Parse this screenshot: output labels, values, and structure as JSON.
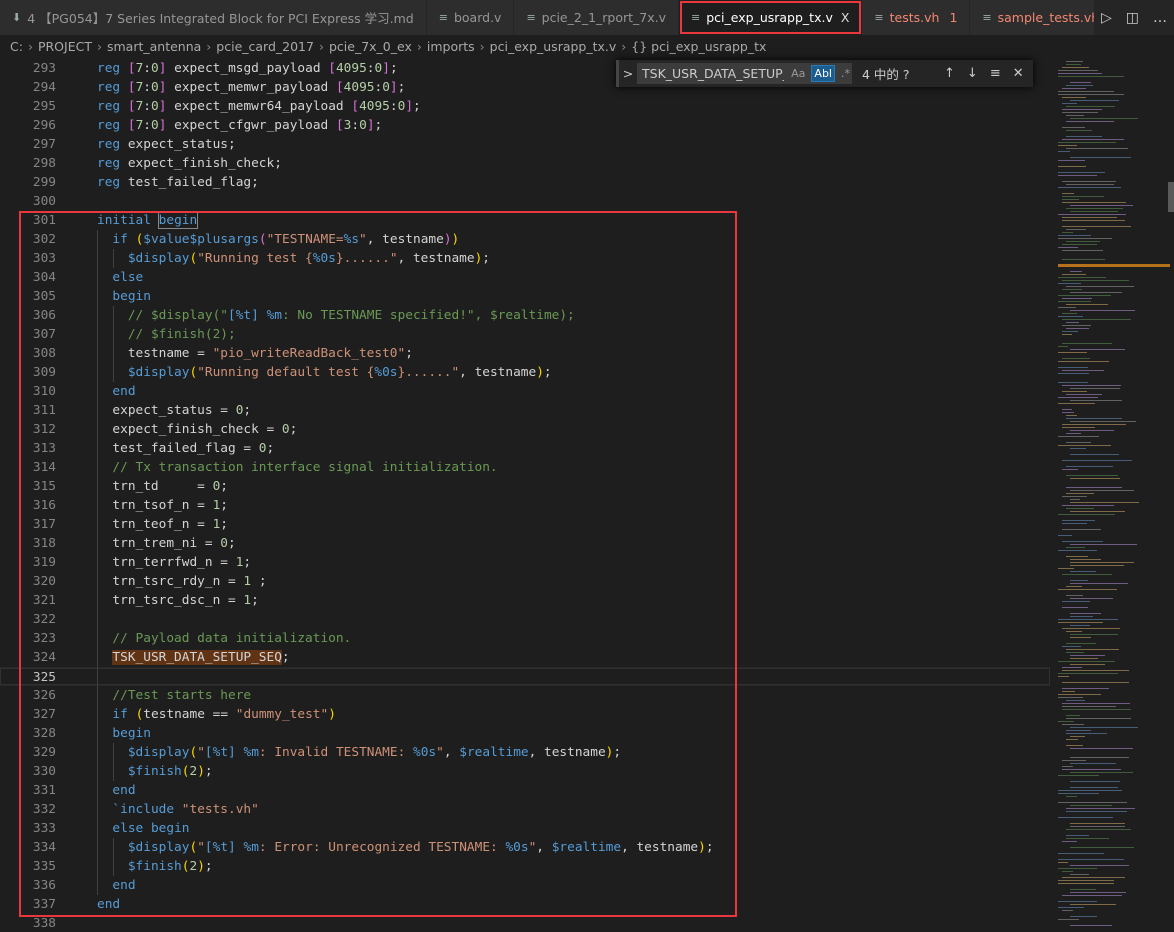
{
  "tabs": [
    {
      "label": "4 【PG054】7 Series Integrated Block for PCI Express 学习.md",
      "icon": "markdown-download-icon"
    },
    {
      "label": "board.v",
      "icon": "file-icon"
    },
    {
      "label": "pcie_2_1_rport_7x.v",
      "icon": "file-icon"
    },
    {
      "label": "pci_exp_usrapp_tx.v",
      "icon": "file-icon",
      "active": true,
      "close": "X"
    },
    {
      "label": "tests.vh",
      "icon": "file-icon",
      "badge": "1",
      "error": true
    },
    {
      "label": "sample_tests.vh",
      "icon": "file-icon",
      "error": true
    }
  ],
  "tab_actions": {
    "run": "▷",
    "split": "◫",
    "more": "…"
  },
  "breadcrumb": [
    "C:",
    "PROJECT",
    "smart_antenna",
    "pcie_card_2017",
    "pcie_7x_0_ex",
    "imports",
    "pci_exp_usrapp_tx.v",
    "{} pci_exp_usrapp_tx"
  ],
  "find": {
    "toggle": ">",
    "value": "TSK_USR_DATA_SETUP_SEQ",
    "match_case": "Aa",
    "whole_word": "Abl",
    "regex": ".*",
    "result": "4 中的 ?",
    "prev": "↑",
    "next": "↓",
    "selection": "≡",
    "close": "✕"
  },
  "editor": {
    "first_line": 293,
    "current_line": 325,
    "lines": [
      "reg [7:0] expect_msgd_payload [4095:0];",
      "reg [7:0] expect_memwr_payload [4095:0];",
      "reg [7:0] expect_memwr64_payload [4095:0];",
      "reg [7:0] expect_cfgwr_payload [3:0];",
      "reg expect_status;",
      "reg expect_finish_check;",
      "reg test_failed_flag;",
      "",
      "initial begin",
      "  if ($value$plusargs(\"TESTNAME=%s\", testname))",
      "    $display(\"Running test {%0s}......\", testname);",
      "  else",
      "  begin",
      "    // $display(\"[%t] %m: No TESTNAME specified!\", $realtime);",
      "    // $finish(2);",
      "    testname = \"pio_writeReadBack_test0\";",
      "    $display(\"Running default test {%0s}......\", testname);",
      "  end",
      "  expect_status = 0;",
      "  expect_finish_check = 0;",
      "  test_failed_flag = 0;",
      "  // Tx transaction interface signal initialization.",
      "  trn_td     = 0;",
      "  trn_tsof_n = 1;",
      "  trn_teof_n = 1;",
      "  trn_trem_ni = 0;",
      "  trn_terrfwd_n = 1;",
      "  trn_tsrc_rdy_n = 1 ;",
      "  trn_tsrc_dsc_n = 1;",
      "",
      "  // Payload data initialization.",
      "  TSK_USR_DATA_SETUP_SEQ;",
      "",
      "  //Test starts here",
      "  if (testname == \"dummy_test\")",
      "  begin",
      "    $display(\"[%t] %m: Invalid TESTNAME: %0s\", $realtime, testname);",
      "    $finish(2);",
      "  end",
      "  `include \"tests.vh\"",
      "  else begin",
      "    $display(\"[%t] %m: Error: Unrecognized TESTNAME: %0s\", $realtime, testname);",
      "    $finish(2);",
      "  end",
      "end",
      ""
    ],
    "search_highlight": "TSK_USR_DATA_SETUP_SEQ"
  },
  "colors": {
    "keyword": "#569cd6",
    "string": "#ce9178",
    "number": "#b5cea8",
    "comment": "#6a9955",
    "highlight_box": "#e8383d",
    "search_match": "#613315"
  }
}
